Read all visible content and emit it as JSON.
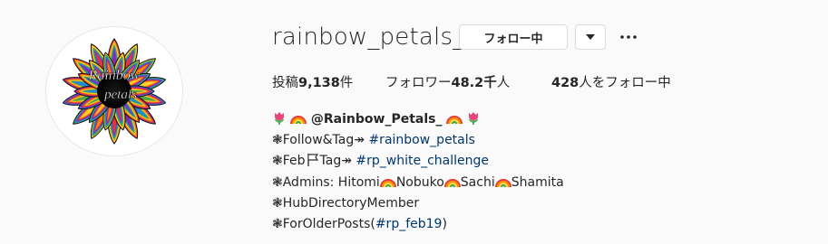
{
  "profile": {
    "username": "rainbow_petals_",
    "avatar_logo_text": "Rainbow petals",
    "follow_button_label": "フォロー中",
    "stats": {
      "posts_label": "投稿",
      "posts_count": "9,138",
      "posts_unit": "件",
      "followers_label": "フォロワー",
      "followers_count": "48.2千",
      "followers_unit": "人",
      "following_count": "428",
      "following_label": "人をフォロー中"
    },
    "bio": {
      "name": "@Rainbow_Petals_",
      "line2_prefix": "❃Follow&Tag↠ ",
      "line2_tag": "#rainbow_petals",
      "line3_prefix": "❃Feb",
      "line3_mid": "Tag↠ ",
      "line3_tag": "#rp_white_challenge",
      "line4_prefix": "❃Admins: Hitomi",
      "line4_a": "Nobuko",
      "line4_b": "Sachi",
      "line4_c": "Shamita",
      "line5": "❃HubDirectoryMember",
      "line6_prefix": "❃ForOlderPosts(",
      "line6_tag": "#rp_feb19",
      "line6_suffix": ")"
    }
  },
  "icons": [
    "tulip-icon",
    "rainbow-icon",
    "white-flag-icon",
    "chevron-down-icon",
    "more-options-icon"
  ],
  "colors": {
    "text": "#262626",
    "hashtag": "#00376b",
    "border": "#dbdbdb",
    "background": "#fafafa"
  }
}
